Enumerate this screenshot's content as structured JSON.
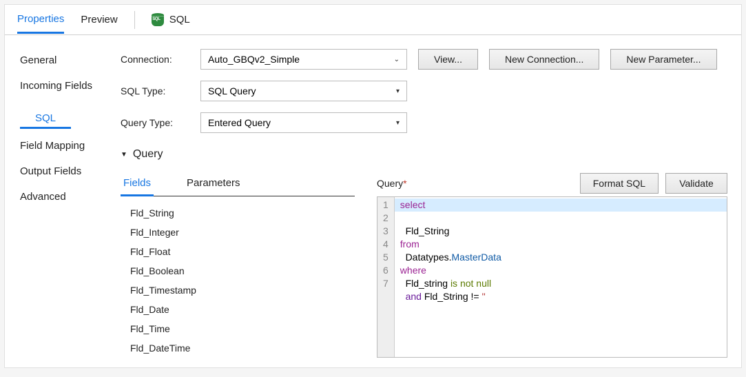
{
  "topTabs": {
    "properties": "Properties",
    "preview": "Preview",
    "sql": "SQL"
  },
  "sidebar": {
    "general": "General",
    "incoming": "Incoming Fields",
    "sql": "SQL",
    "mapping": "Field Mapping",
    "output": "Output Fields",
    "advanced": "Advanced"
  },
  "form": {
    "connection_label": "Connection:",
    "connection_value": "Auto_GBQv2_Simple",
    "view_btn": "View...",
    "new_conn_btn": "New Connection...",
    "new_param_btn": "New Parameter...",
    "sqltype_label": "SQL Type:",
    "sqltype_value": "SQL Query",
    "querytype_label": "Query Type:",
    "querytype_value": "Entered Query"
  },
  "query": {
    "section_label": "Query",
    "tabs": {
      "fields": "Fields",
      "parameters": "Parameters"
    },
    "fields": [
      "Fld_String",
      "Fld_Integer",
      "Fld_Float",
      "Fld_Boolean",
      "Fld_Timestamp",
      "Fld_Date",
      "Fld_Time",
      "Fld_DateTime"
    ],
    "editor_label": "Query",
    "format_btn": "Format SQL",
    "validate_btn": "Validate",
    "lines": [
      "1",
      "2",
      "3",
      "4",
      "5",
      "6",
      "7"
    ]
  },
  "chart_data": {
    "type": "table",
    "title": "SQL Query editor",
    "sql": "select\n  Fld_String\nfrom\n  Datatypes.MasterData\nwhere\n  Fld_string is not null\n  and Fld_String != ''",
    "tokens_by_line": [
      [
        {
          "t": "select",
          "c": "kw"
        }
      ],
      [
        {
          "t": "  Fld_String",
          "c": ""
        }
      ],
      [
        {
          "t": "from",
          "c": "kw"
        }
      ],
      [
        {
          "t": "  Datatypes.",
          "c": ""
        },
        {
          "t": "MasterData",
          "c": "id"
        }
      ],
      [
        {
          "t": "where",
          "c": "kw"
        }
      ],
      [
        {
          "t": "  Fld_string ",
          "c": ""
        },
        {
          "t": "is not null",
          "c": "fn"
        }
      ],
      [
        {
          "t": "  ",
          "c": ""
        },
        {
          "t": "and",
          "c": "op"
        },
        {
          "t": " Fld_String != ",
          "c": ""
        },
        {
          "t": "''",
          "c": "str"
        }
      ]
    ]
  }
}
